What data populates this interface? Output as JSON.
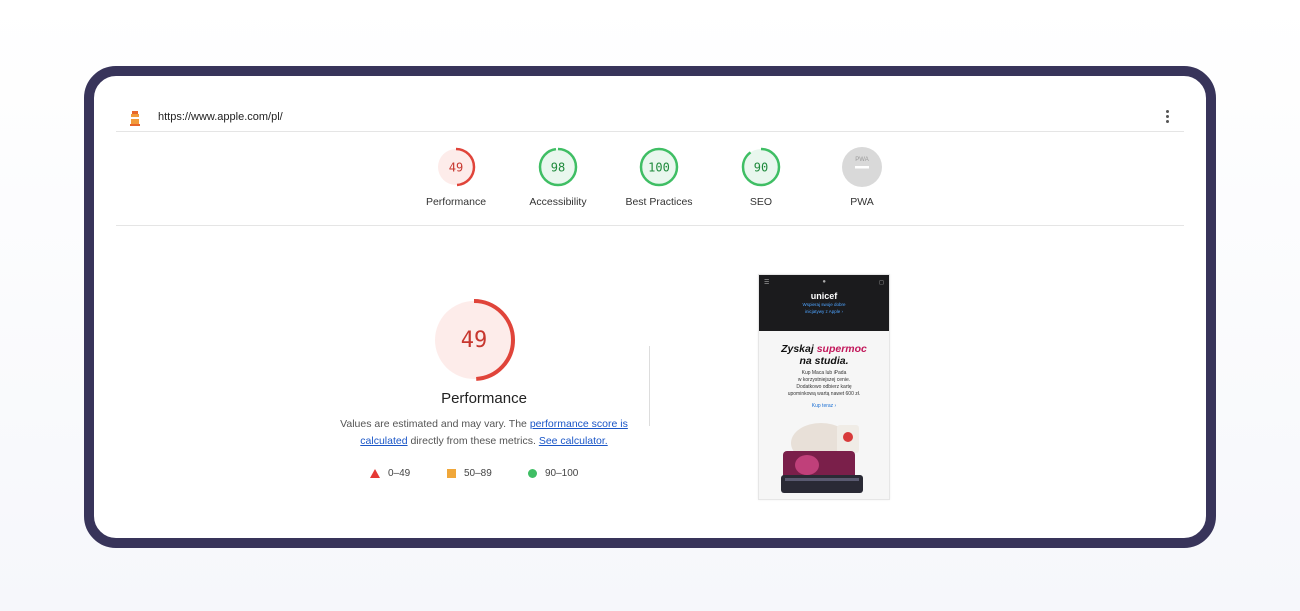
{
  "header": {
    "url": "https://www.apple.com/pl/"
  },
  "gauges": [
    {
      "score": "49",
      "label": "Performance",
      "value": 49,
      "color": "#e0443a",
      "fill": "#fdecea",
      "text_color": "#c7372f"
    },
    {
      "score": "98",
      "label": "Accessibility",
      "value": 98,
      "color": "#3fbe64",
      "fill": "#e9f7ee",
      "text_color": "#1f8a3c"
    },
    {
      "score": "100",
      "label": "Best Practices",
      "value": 100,
      "color": "#3fbe64",
      "fill": "#e9f7ee",
      "text_color": "#1f8a3c"
    },
    {
      "score": "90",
      "label": "SEO",
      "value": 90,
      "color": "#3fbe64",
      "fill": "#e9f7ee",
      "text_color": "#1f8a3c"
    },
    {
      "score": "PWA",
      "label": "PWA",
      "value": null,
      "color": "#cccccc",
      "fill": "#d9d9d9",
      "text_color": "#ffffff"
    }
  ],
  "performance": {
    "score": "49",
    "value": 49,
    "title": "Performance",
    "desc_prefix": "Values are estimated and may vary. The ",
    "link_score": "performance score is calculated",
    "desc_middle": " directly from these metrics. ",
    "link_calc": "See calculator."
  },
  "legend": [
    {
      "range": "0–49",
      "shape": "triangle",
      "color": "#e53935"
    },
    {
      "range": "50–89",
      "shape": "square",
      "color": "#f0a73a"
    },
    {
      "range": "90–100",
      "shape": "circle",
      "color": "#3fbe64"
    }
  ],
  "screenshot": {
    "brand": "unicef",
    "sub_line1": "Wspieraj swoje dobre",
    "sub_line2": "inicjatywy z Apple ›",
    "headline_a": "Zyskaj ",
    "headline_pink": "supermoc",
    "headline_b": "na studia.",
    "body1": "Kup Maca lub iPada",
    "body2": "w korzystniejszej cenie.",
    "body3": "Dodatkowo odbierz kartę",
    "body4": "upominkową wartą nawet 600 zł.",
    "cta": "Kup teraz ›"
  }
}
